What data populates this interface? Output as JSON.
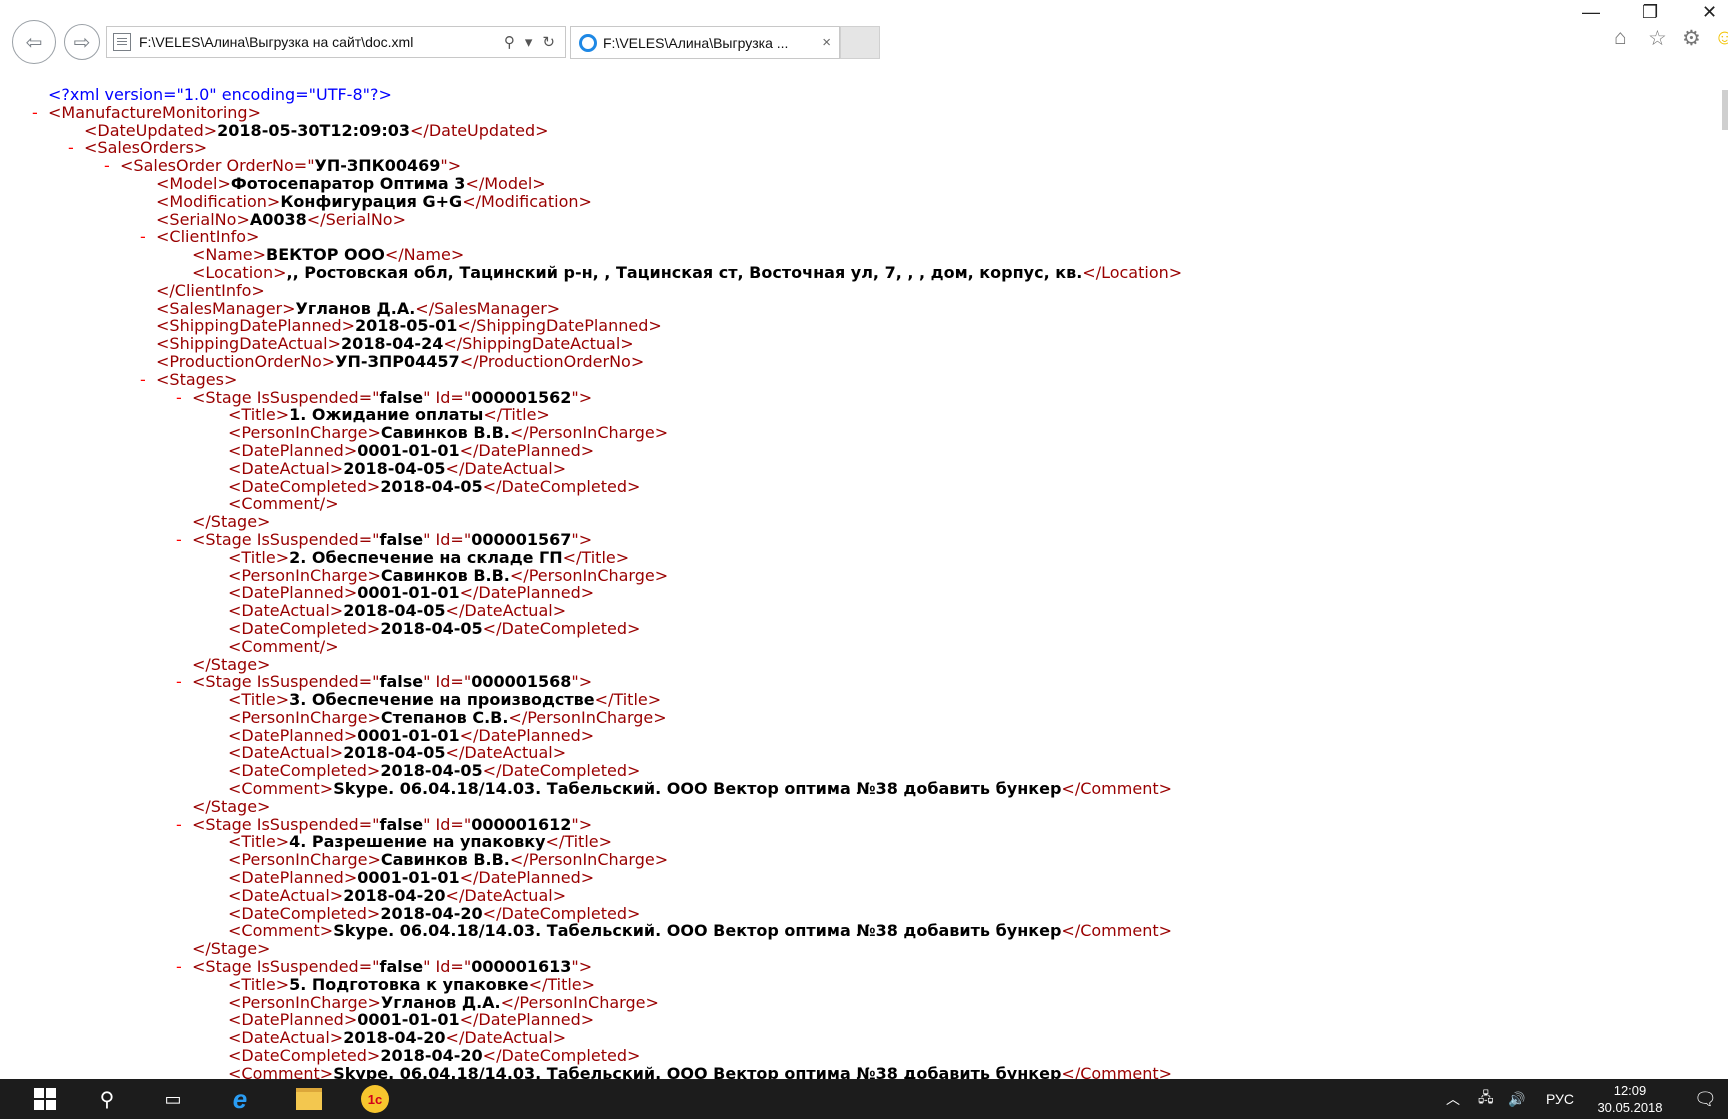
{
  "browser": {
    "address": "F:\\VELES\\Алина\\Выгрузка на сайт\\doc.xml",
    "search_icon": "search-icon",
    "tab_title": "F:\\VELES\\Алина\\Выгрузка ...",
    "tab_close": "×",
    "window": {
      "minimize": "—",
      "restore": "❐",
      "close": "✕"
    }
  },
  "xml": {
    "declaration": "<?xml version=\"1.0\" encoding=\"UTF-8\"?>",
    "root": "ManufactureMonitoring",
    "date_updated": "2018-05-30T12:09:03",
    "order_no": "УП-ЗПК00469",
    "model": "Фотосепаратор Оптима 3",
    "modification": "Конфигурация G+G",
    "serial_no": "A0038",
    "client_name": "ВЕКТОР ООО",
    "client_location": ",, Ростовская обл, Тацинский р-н, , Тацинская ст, Восточная ул, 7, , , дом, корпус, кв.",
    "sales_manager": "Угланов Д.А.",
    "shipping_planned": "2018-05-01",
    "shipping_actual": "2018-04-24",
    "production_order_no": "УП-ЗПР04457",
    "stages": [
      {
        "suspended": "false",
        "id": "000001562",
        "title": "1. Ожидание оплаты",
        "person": "Савинков В.В.",
        "planned": "0001-01-01",
        "actual": "2018-04-05",
        "completed": "2018-04-05",
        "comment": ""
      },
      {
        "suspended": "false",
        "id": "000001567",
        "title": "2. Обеспечение на складе ГП",
        "person": "Савинков В.В.",
        "planned": "0001-01-01",
        "actual": "2018-04-05",
        "completed": "2018-04-05",
        "comment": ""
      },
      {
        "suspended": "false",
        "id": "000001568",
        "title": "3. Обеспечение на производстве",
        "person": "Степанов С.В.",
        "planned": "0001-01-01",
        "actual": "2018-04-05",
        "completed": "2018-04-05",
        "comment": "Skype. 06.04.18/14.03. Табельский. ООО Вектор оптима №38 добавить бункер"
      },
      {
        "suspended": "false",
        "id": "000001612",
        "title": "4. Разрешение на упаковку",
        "person": "Савинков В.В.",
        "planned": "0001-01-01",
        "actual": "2018-04-20",
        "completed": "2018-04-20",
        "comment": "Skype. 06.04.18/14.03. Табельский. ООО Вектор оптима №38 добавить бункер"
      },
      {
        "suspended": "false",
        "id": "000001613",
        "title": "5. Подготовка к упаковке",
        "person": "Угланов Д.А.",
        "planned": "0001-01-01",
        "actual": "2018-04-20",
        "completed": "2018-04-20",
        "comment": "Skype. 06.04.18/14.03. Табельский. ООО Вектор оптима №38 добавить бункер"
      }
    ]
  },
  "taskbar": {
    "language": "РУС",
    "time": "12:09",
    "date": "30.05.2018",
    "icons": [
      "windows-start-icon",
      "search-icon",
      "task-view-icon",
      "internet-explorer-icon",
      "file-explorer-icon",
      "1c-icon"
    ]
  },
  "colors": {
    "tag": "#990000",
    "markup": "#ff0000",
    "declaration": "#0000ff",
    "taskbar": "#1c1c1c"
  }
}
